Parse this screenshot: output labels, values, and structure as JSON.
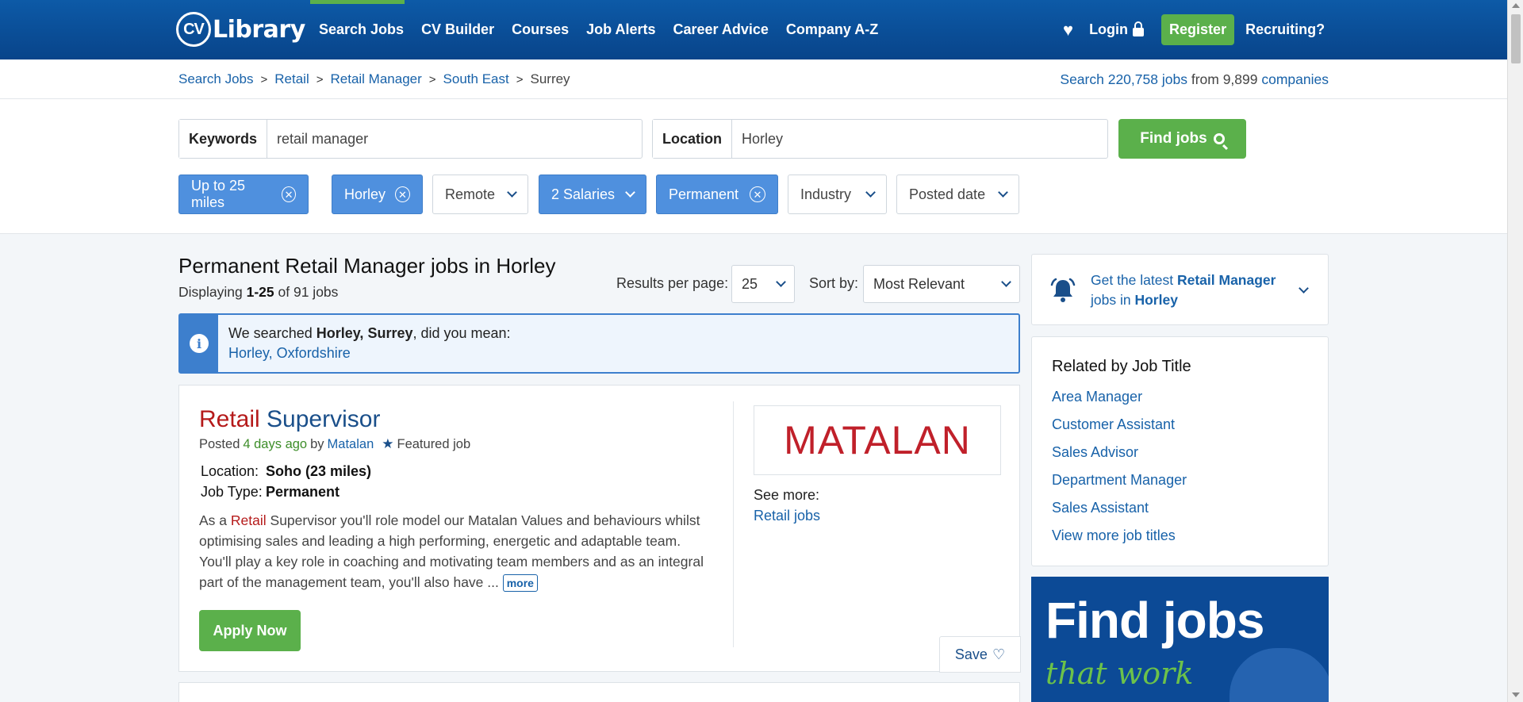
{
  "header": {
    "logo_cv": "CV",
    "logo_text": "Library",
    "nav": [
      "Search Jobs",
      "CV Builder",
      "Courses",
      "Job Alerts",
      "Career Advice",
      "Company A-Z"
    ],
    "login_label": "Login",
    "register_label": "Register",
    "recruiting_label": "Recruiting?"
  },
  "breadcrumb": {
    "items": [
      "Search Jobs",
      "Retail",
      "Retail Manager",
      "South East"
    ],
    "current": "Surrey"
  },
  "job_stats": {
    "prefix": "Search",
    "jobs_link": "220,758 jobs",
    "middle": "from 9,899",
    "companies_link": "companies"
  },
  "search": {
    "keywords_label": "Keywords",
    "keywords_value": "retail manager",
    "location_label": "Location",
    "location_value": "Horley",
    "find_label": "Find jobs"
  },
  "filters": [
    {
      "label": "Up to 25 miles",
      "active": true
    },
    {
      "label": "Horley",
      "active": true
    },
    {
      "label": "Remote",
      "active": false
    },
    {
      "label": "2 Salaries",
      "active": true
    },
    {
      "label": "Permanent",
      "active": true
    },
    {
      "label": "Industry",
      "active": false
    },
    {
      "label": "Posted date",
      "active": false
    }
  ],
  "results": {
    "title": "Permanent Retail Manager jobs in Horley",
    "displaying_prefix": "Displaying",
    "displaying_range": "1-25",
    "displaying_suffix": "of 91 jobs",
    "per_page_label": "Results per page:",
    "per_page_value": "25",
    "sort_label": "Sort by:",
    "sort_value": "Most Relevant"
  },
  "suggestion": {
    "prefix": "We searched",
    "searched": "Horley, Surrey",
    "suffix": ", did you mean:",
    "link": "Horley, Oxfordshire"
  },
  "job": {
    "title_highlight": "Retail",
    "title_rest": "Supervisor",
    "posted_prefix": "Posted",
    "posted_when": "4 days ago",
    "posted_by": "by",
    "company": "Matalan",
    "featured": "Featured job",
    "location_label": "Location:",
    "location_value": "Soho (23 miles)",
    "type_label": "Job Type:",
    "type_value": "Permanent",
    "desc_prefix": "As a",
    "desc_highlight": "Retail",
    "desc_rest": "Supervisor you'll role model our Matalan Values and behaviours whilst optimising sales and leading a high performing, energetic and adaptable team. You'll play a key role in coaching and motivating team members and as an integral part of the management team, you'll also have ...",
    "more_label": "more",
    "apply_label": "Apply Now",
    "logo_text": "MATALAN",
    "see_more_label": "See more:",
    "see_more_link": "Retail jobs",
    "save_label": "Save"
  },
  "sidebar": {
    "alert_prefix": "Get the latest",
    "alert_role": "Retail Manager",
    "alert_mid": "jobs in",
    "alert_location": "Horley",
    "related_title": "Related by Job Title",
    "related": [
      "Area Manager",
      "Customer Assistant",
      "Sales Advisor",
      "Department Manager",
      "Sales Assistant",
      "View more job titles"
    ],
    "ad_headline": "Find jobs",
    "ad_sub": "that work"
  },
  "colors": {
    "brand_blue": "#0d5aa7",
    "accent_green": "#5bb04b",
    "chip_active": "#4f90de",
    "link": "#1862a9",
    "highlight_red": "#b51a1a"
  }
}
